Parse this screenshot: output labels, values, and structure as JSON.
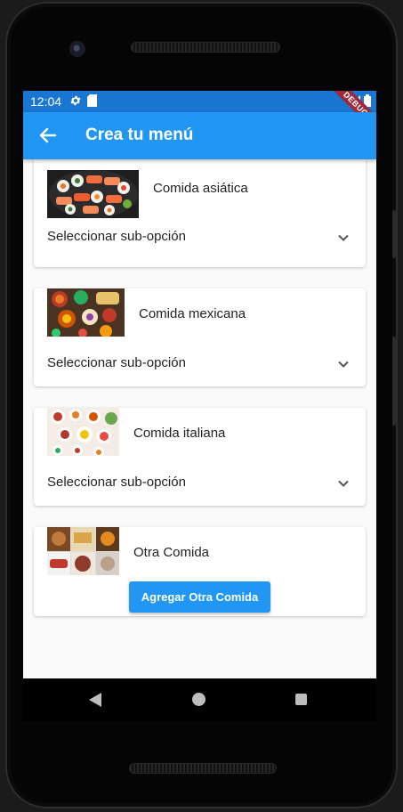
{
  "status": {
    "time": "12:04",
    "debug": "DEBUG"
  },
  "appbar": {
    "title": "Crea tu menú"
  },
  "cards": [
    {
      "title": "Comida asiática",
      "dropdown": "Seleccionar sub-opción",
      "image": "sushi-platter-image"
    },
    {
      "title": "Comida mexicana",
      "dropdown": "Seleccionar sub-opción",
      "image": "mexican-food-image"
    },
    {
      "title": "Comida italiana",
      "dropdown": "Seleccionar sub-opción",
      "image": "italian-food-image"
    },
    {
      "title": "Otra Comida",
      "button": "Agregar Otra Comida",
      "image": "assorted-food-collage-image"
    }
  ],
  "colors": {
    "appbar": "#2196f3",
    "statusbar": "#1976d2",
    "button": "#2196f3",
    "debug_ribbon": "#9c2a3c"
  }
}
